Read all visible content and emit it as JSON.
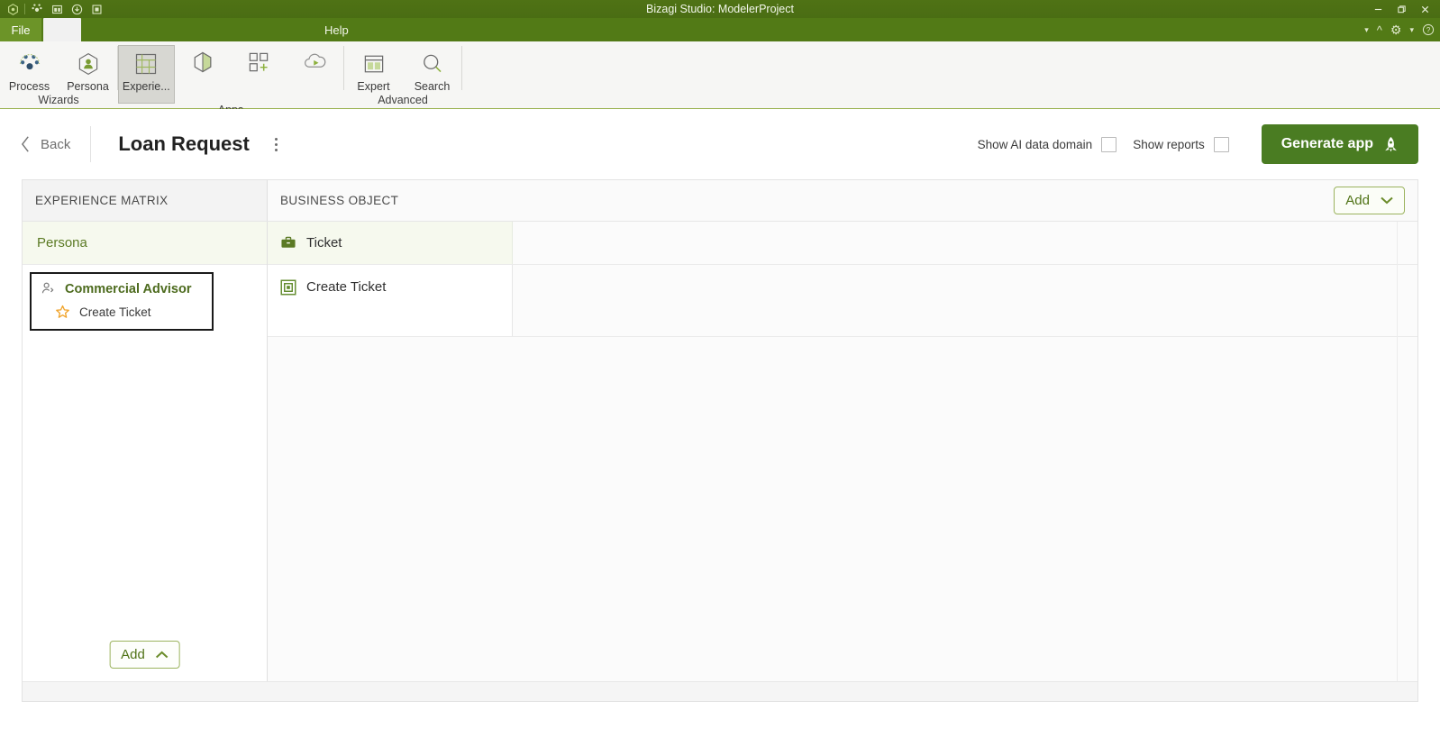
{
  "titlebar": {
    "title": "Bizagi Studio: ModelerProject",
    "quick_access": [
      {
        "name": "bizagi-logo-icon",
        "label": "Bizagi"
      },
      {
        "name": "process-dots-icon",
        "label": "Process"
      },
      {
        "name": "window-icon",
        "label": "Window"
      },
      {
        "name": "download-icon",
        "label": "Download"
      },
      {
        "name": "matrix-icon",
        "label": "Matrix"
      }
    ],
    "window_controls": [
      {
        "name": "minimize-button",
        "glyph": "−"
      },
      {
        "name": "restore-button",
        "glyph": "❐"
      },
      {
        "name": "close-button",
        "glyph": "✕"
      }
    ]
  },
  "tabs": {
    "file_label": "File",
    "help_label": "Help",
    "right_icons": [
      {
        "name": "dropdown-caret-icon",
        "glyph": "▾"
      },
      {
        "name": "collapse-ribbon-icon",
        "glyph": "˄"
      },
      {
        "name": "settings-gear-icon",
        "glyph": "⚙"
      },
      {
        "name": "options-caret-icon",
        "glyph": "▾"
      },
      {
        "name": "help-circle-icon",
        "glyph": "?"
      }
    ]
  },
  "ribbon": {
    "groups": [
      {
        "label": "Wizards",
        "buttons": [
          {
            "label": "Process",
            "icon": "process-network-icon",
            "selected": false
          },
          {
            "label": "Persona",
            "icon": "persona-icon",
            "selected": false
          }
        ]
      },
      {
        "label": "Apps",
        "buttons": [
          {
            "label": "Experie...",
            "icon": "experience-matrix-icon",
            "selected": true
          },
          {
            "label": "",
            "icon": "cube-shape-icon",
            "selected": false
          },
          {
            "label": "",
            "icon": "add-app-icon",
            "selected": false
          },
          {
            "label": "",
            "icon": "cloud-deploy-icon",
            "selected": false
          }
        ]
      },
      {
        "label": "Advanced",
        "buttons": [
          {
            "label": "Expert",
            "icon": "expert-layout-icon",
            "selected": false
          },
          {
            "label": "Search",
            "icon": "search-icon",
            "selected": false
          }
        ]
      }
    ]
  },
  "header": {
    "back_label": "Back",
    "title": "Loan Request",
    "kebab_name": "more-options-menu",
    "checkboxes": [
      {
        "label": "Show AI data domain",
        "checked": false
      },
      {
        "label": "Show reports",
        "checked": false
      }
    ],
    "generate_button": {
      "label": "Generate app",
      "icon": "rocket-icon"
    }
  },
  "matrix": {
    "columns": [
      {
        "label": "EXPERIENCE MATRIX"
      },
      {
        "label": "BUSINESS OBJECT"
      }
    ],
    "add_top": {
      "label": "Add",
      "chevron": "down"
    },
    "add_bottom": {
      "label": "Add",
      "chevron": "up"
    },
    "persona_row_label": "Persona",
    "business_object": {
      "label": "Ticket",
      "icon": "briefcase-icon"
    },
    "persona_card": {
      "name": "Commercial Advisor",
      "icon": "persona-small-icon",
      "task": {
        "label": "Create Ticket",
        "icon": "star-icon"
      }
    },
    "task_item": {
      "label": "Create Ticket",
      "icon": "form-squares-icon"
    }
  },
  "colors": {
    "brand_green": "#4f7215",
    "accent_button": "#4a7c22",
    "star_orange": "#f0a32a",
    "persona_label": "#5b7a24"
  }
}
